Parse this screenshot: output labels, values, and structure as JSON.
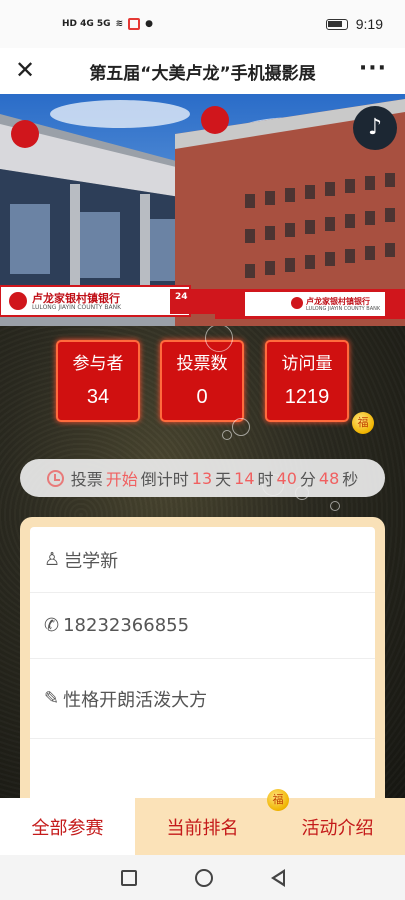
{
  "status_bar": {
    "network": "HD 4G 5G",
    "time": "9:19"
  },
  "header": {
    "title": "第五届“大美卢龙”手机摄影展"
  },
  "hero": {
    "sign_left_cn": "卢龙家银村镇银行",
    "sign_left_en": "LULONG JIAYIN COUNTY BANK",
    "sign_right_cn": "卢龙家银村镇银行",
    "sign_right_en": "LULONG JIAYIN COUNTY BANK",
    "badge": "24"
  },
  "stats": [
    {
      "label": "参与者",
      "value": "34"
    },
    {
      "label": "投票数",
      "value": "0"
    },
    {
      "label": "访问量",
      "value": "1219"
    }
  ],
  "countdown": {
    "prefix": "投票",
    "status": "开始",
    "label": "倒计时",
    "days": "13",
    "days_unit": "天",
    "hours": "14",
    "hours_unit": "时",
    "minutes": "40",
    "minutes_unit": "分",
    "seconds": "48",
    "seconds_unit": "秒"
  },
  "profile": {
    "name": "岂学新",
    "phone": "18232366855",
    "description": "性格开朗活泼大方"
  },
  "tabs": [
    {
      "label": "全部参赛"
    },
    {
      "label": "当前排名"
    },
    {
      "label": "活动介绍"
    }
  ],
  "colors": {
    "accent": "#d01010",
    "tab_bg": "#fbe2b8",
    "countdown_red": "#f06060"
  }
}
